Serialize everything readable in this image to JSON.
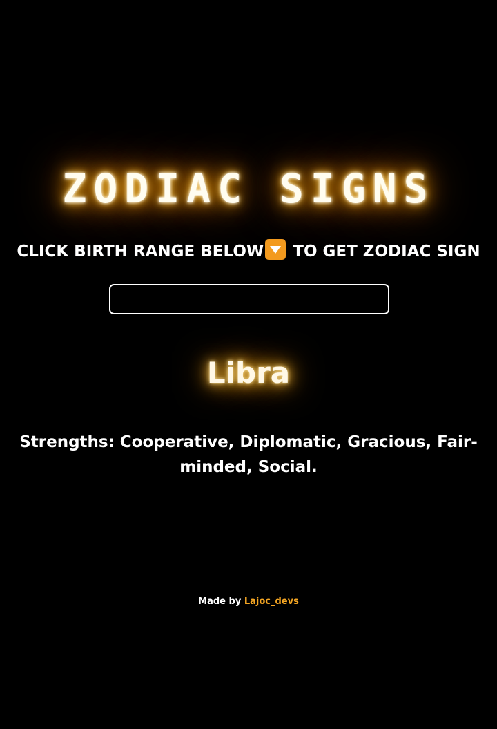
{
  "header": {
    "title": "ZODIAC SIGNS"
  },
  "instruction": {
    "text_before": "CLICK BIRTH RANGE BELOW",
    "icon": "down-arrow-button-icon",
    "text_after": " TO GET ZODIAC SIGN"
  },
  "birth_range_select": {
    "selected_value": ""
  },
  "result": {
    "sign": "Libra",
    "strengths": "Strengths: Cooperative, Diplomatic, Gracious, Fair-minded, Social."
  },
  "footer": {
    "made_by": "Made by ",
    "author_link": "Lajoc_devs"
  },
  "colors": {
    "background": "#000000",
    "glow": "#ffae00",
    "accent": "#f39a1e",
    "link": "#f5a623"
  }
}
